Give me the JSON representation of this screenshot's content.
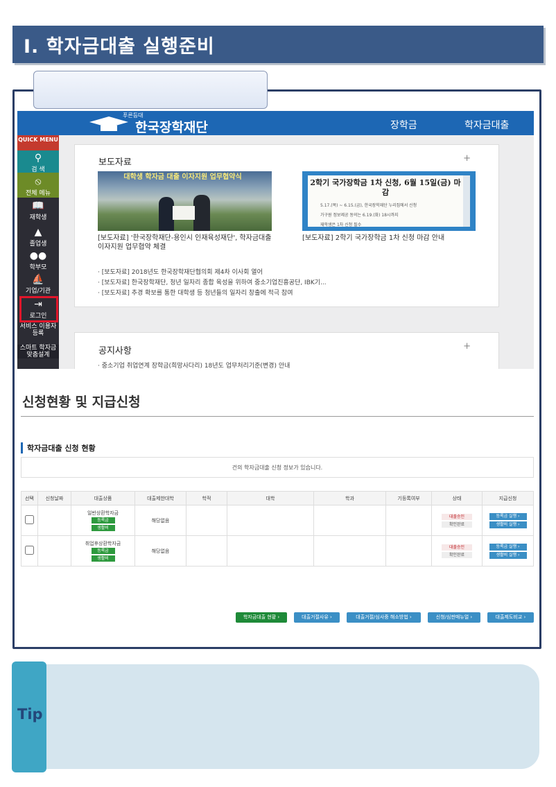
{
  "section_title": "Ⅰ. 학자금대출 실행준비",
  "kosaf": {
    "logo_tagline": "푸른등대",
    "logo_name": "한국장학재단",
    "nav": [
      "장학금",
      "학자금대출"
    ],
    "sidebar": [
      {
        "label": "QUICK MENU",
        "icon": "quick-menu"
      },
      {
        "label": "검 색",
        "icon": "search-icon"
      },
      {
        "label": "전체 메뉴",
        "icon": "all-menu-icon"
      },
      {
        "label": "재학생",
        "icon": "book-icon"
      },
      {
        "label": "졸업생",
        "icon": "graduation-cap-icon"
      },
      {
        "label": "학부모",
        "icon": "people-icon"
      },
      {
        "label": "기업/기관",
        "icon": "institution-icon"
      },
      {
        "label": "로그인",
        "icon": "login-icon"
      },
      {
        "label": "서비스 이용자 등록",
        "icon": ""
      },
      {
        "label": "스마트 학자금 맞춤설계",
        "icon": ""
      }
    ],
    "press": {
      "title": "보도자료",
      "photo_banner": "대학생 학자금 대출 이자지원 업무협약식",
      "photo_caption": "[보도자료] '한국장학재단-용인시 인재육성재단', 학자금대출 이자지원 업무협약 체결",
      "notice_heading": "2학기 국가장학금 1차 신청, 6월 15일(금) 마감",
      "notice_lines": [
        "5.17.(목) ~ 6.15.(금), 한국장학재단 누리집에서 신청",
        "가구원 정보제공 동의는 6.19.(화) 18시까지",
        "재학생은 1차 신청 필수"
      ],
      "notice_caption": "[보도자료] 2학기 국가장학금 1차 신청 마감 안내",
      "items": [
        "[보도자료] 2018년도 한국장학재단협의회 제4차 이사회 열어",
        "[보도자료] 한국장학재단, 청년 일자리 종합 육성을 위하여 중소기업진흥공단, IBK기...",
        "[보도자료] 추경 확보를 통한 대학생 등 청년들의 일자리 창출에 적극 참여"
      ]
    },
    "notice": {
      "title": "공지사항",
      "items": [
        "중소기업 취업연계 장학금(희망사다리) 18년도 업무처리기준(변경) 안내"
      ]
    }
  },
  "status_page": {
    "title": "신청현황 및 지급신청",
    "subtitle": "학자금대출 신청 현황",
    "info": "건의 학자금대출 신청 정보가 있습니다.",
    "columns": [
      "선택",
      "신청날짜",
      "대출상품",
      "대출제한대학",
      "학적",
      "대학",
      "학과",
      "기등록여부",
      "상태",
      "지급신청"
    ],
    "rows": [
      {
        "product": "일반상환학자금",
        "badges": [
          "등록금",
          "생활비"
        ],
        "limit": "해당없음",
        "status": [
          "대출승인",
          "확인완료"
        ],
        "actions": [
          "등록금 실행 ›",
          "생활비 실행 ›"
        ]
      },
      {
        "product": "취업후상환학자금",
        "badges": [
          "등록금",
          "생활비"
        ],
        "limit": "해당없음",
        "status": [
          "대출승인",
          "확인완료"
        ],
        "actions": [
          "등록금 실행 ›",
          "생활비 실행 ›"
        ]
      }
    ],
    "buttons": [
      "학자금대출 현황 ›",
      "대출거절사유 ›",
      "대출거절/심사중 해소방법 ›",
      "신청/심판매뉴얼 ›",
      "대출제도비교 ›"
    ]
  },
  "tip_label": "Tip",
  "colors": {
    "title_bar": "#3a5a88",
    "kosaf_blue": "#1d67b4",
    "highlight": "#e0162b",
    "tip_tab": "#3fa6c5",
    "tip_panel": "#d5e5ee"
  }
}
